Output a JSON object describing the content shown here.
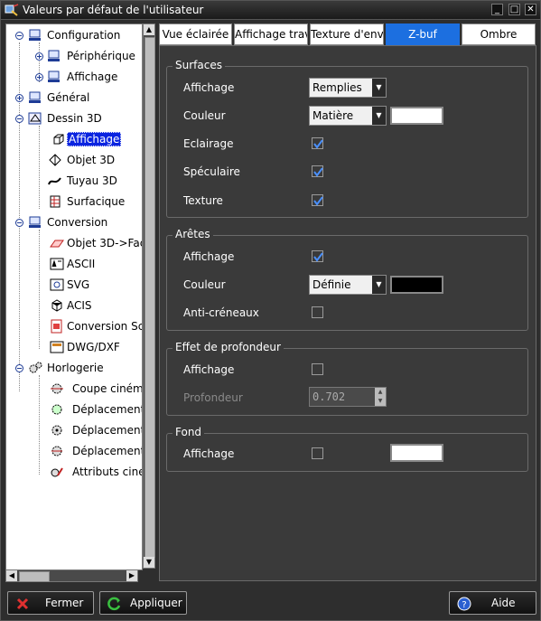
{
  "window": {
    "title": "Valeurs par défaut de l'utilisateur",
    "minimize_glyph": "_",
    "maximize_glyph": "□",
    "close_glyph": "✕"
  },
  "tree": {
    "items": [
      {
        "label": "Configuration"
      },
      {
        "label": "Périphérique"
      },
      {
        "label": "Affichage"
      },
      {
        "label": "Général"
      },
      {
        "label": "Dessin 3D"
      },
      {
        "label": "Affichage"
      },
      {
        "label": "Objet 3D"
      },
      {
        "label": "Tuyau 3D"
      },
      {
        "label": "Surfacique"
      },
      {
        "label": "Conversion"
      },
      {
        "label": "Objet 3D->Fac"
      },
      {
        "label": "ASCII"
      },
      {
        "label": "SVG"
      },
      {
        "label": "ACIS"
      },
      {
        "label": "Conversion Sc"
      },
      {
        "label": "DWG/DXF"
      },
      {
        "label": "Horlogerie"
      },
      {
        "label": "Coupe ciném"
      },
      {
        "label": "Déplacement"
      },
      {
        "label": "Déplacement"
      },
      {
        "label": "Déplacement"
      },
      {
        "label": "Attributs ciner"
      }
    ]
  },
  "tabs": [
    {
      "label": "Vue éclairée"
    },
    {
      "label": "Affichage trav"
    },
    {
      "label": "Texture d'envi"
    },
    {
      "label": "Z-buf"
    },
    {
      "label": "Ombre"
    }
  ],
  "surfaces": {
    "title": "Surfaces",
    "affichage_label": "Affichage",
    "affichage_value": "Remplies",
    "couleur_label": "Couleur",
    "couleur_value": "Matière",
    "couleur_swatch": "#ffffff",
    "eclairage_label": "Eclairage",
    "eclairage_checked": true,
    "speculaire_label": "Spéculaire",
    "speculaire_checked": true,
    "texture_label": "Texture",
    "texture_checked": true
  },
  "aretes": {
    "title": "Arêtes",
    "affichage_label": "Affichage",
    "affichage_checked": true,
    "couleur_label": "Couleur",
    "couleur_value": "Définie",
    "couleur_swatch": "#000000",
    "anticreneaux_label": "Anti-créneaux",
    "anticreneaux_checked": false
  },
  "profondeur": {
    "title": "Effet de profondeur",
    "affichage_label": "Affichage",
    "affichage_checked": false,
    "profondeur_label": "Profondeur",
    "profondeur_value": "0.702"
  },
  "fond": {
    "title": "Fond",
    "affichage_label": "Affichage",
    "affichage_checked": false,
    "swatch": "#ffffff"
  },
  "buttons": {
    "fermer": "Fermer",
    "appliquer": "Appliquer",
    "aide": "Aide"
  },
  "colors": {
    "accent": "#1c6fe0",
    "selection": "#0a24e0",
    "check": "#2a6fe8"
  }
}
